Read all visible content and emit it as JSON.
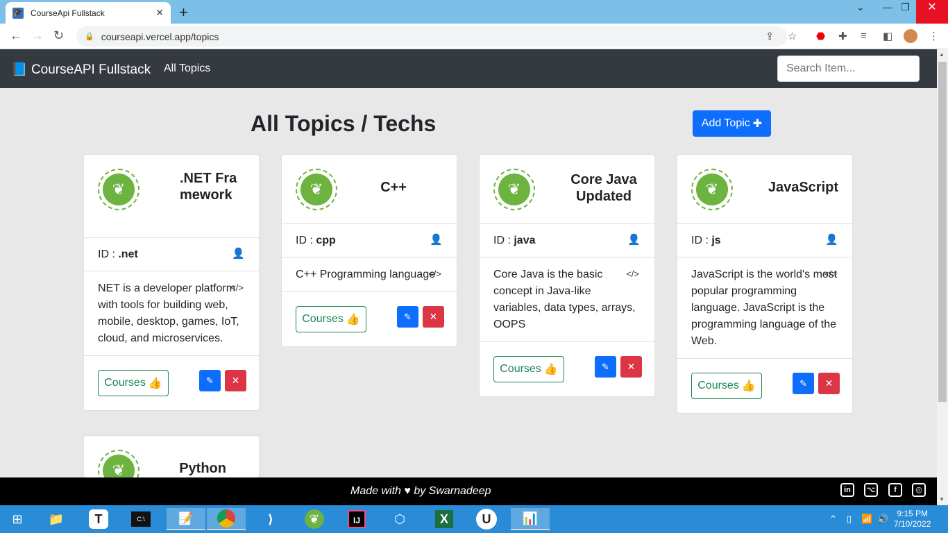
{
  "browser": {
    "tab_title": "CourseApi Fullstack",
    "url": "courseapi.vercel.app/topics"
  },
  "nav": {
    "brand": "CourseAPI Fullstack",
    "link": "All Topics",
    "search_placeholder": "Search Item..."
  },
  "page": {
    "heading": "All Topics / Techs",
    "add_button": "Add Topic"
  },
  "labels": {
    "id_prefix": "ID : ",
    "courses_button": "Courses"
  },
  "topics": [
    {
      "title": ".NET Framework",
      "id": ".net",
      "description": "NET is a developer platform with tools for building web, mobile, desktop, games, IoT, cloud, and microservices."
    },
    {
      "title": "C++",
      "id": "cpp",
      "description": "C++ Programming language"
    },
    {
      "title": "Core Java Updated",
      "id": "java",
      "description": "Core Java is the basic concept in Java-like variables, data types, arrays, OOPS"
    },
    {
      "title": "JavaScript",
      "id": "js",
      "description": "JavaScript is the world's most popular programming language. JavaScript is the programming language of the Web."
    },
    {
      "title": "Python"
    }
  ],
  "footer": {
    "text_before": "Made with",
    "text_after": "by Swarnadeep"
  },
  "taskbar": {
    "time": "9:15 PM",
    "date": "7/10/2022"
  },
  "icons": {
    "card_logo": "spring-leaf-icon",
    "user": "user-icon",
    "code": "code-icon",
    "edit": "pencil-icon",
    "delete": "times-icon",
    "like": "thumbs-up-icon"
  }
}
